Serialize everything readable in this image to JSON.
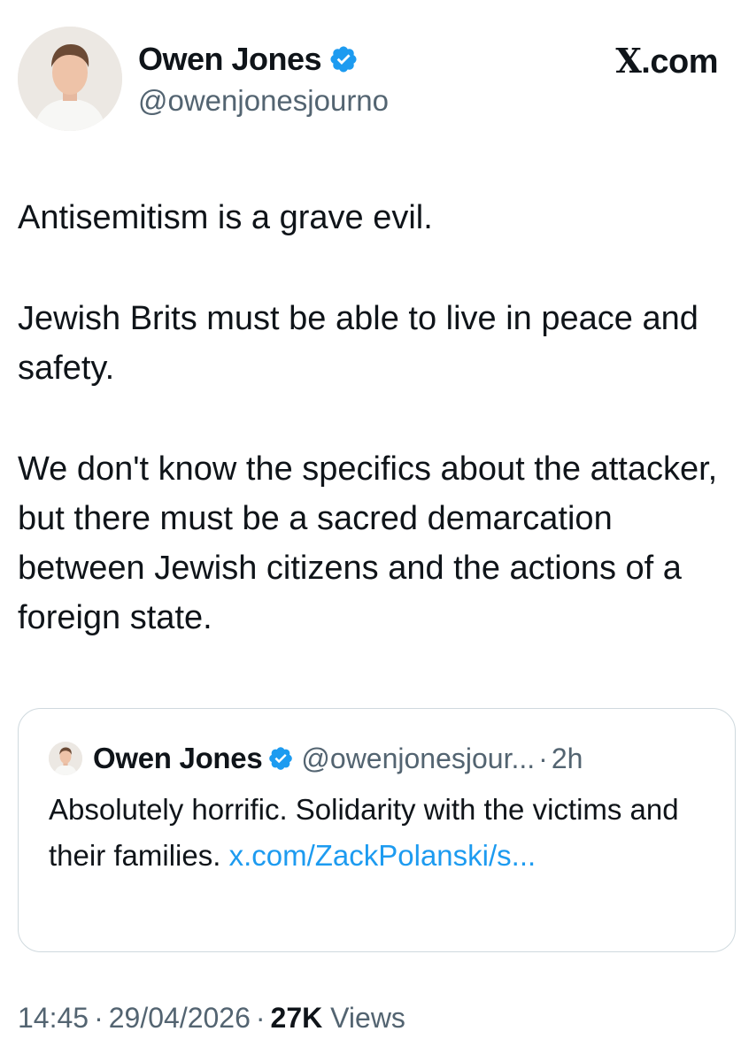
{
  "author": {
    "display_name": "Owen Jones",
    "handle": "@owenjonesjourno",
    "verified_icon": "verified-badge-icon",
    "avatar": "profile-photo"
  },
  "brand": {
    "x_letter": "X",
    "suffix": ".com"
  },
  "tweet": {
    "paragraphs": [
      "Antisemitism is a grave evil.",
      "Jewish Brits must be able to live in peace and safety.",
      "We don't know the specifics about the attacker, but there must be a sacred demarcation between Jewish citizens and the actions of a foreign state."
    ]
  },
  "quote": {
    "display_name": "Owen Jones",
    "handle": "@owenjonesjour...",
    "separator": "·",
    "time": "2h",
    "text": "Absolutely horrific. Solidarity with the victims and their families.",
    "link": "x.com/ZackPolanski/s..."
  },
  "meta": {
    "time": "14:45",
    "separator": "·",
    "date": "29/04/2026",
    "views_count": "27K",
    "views_label": "Views"
  },
  "colors": {
    "text": "#0f1419",
    "secondary": "#536471",
    "link": "#1d9bf0",
    "verified": "#1d9bf0",
    "border": "#cfd9de"
  }
}
